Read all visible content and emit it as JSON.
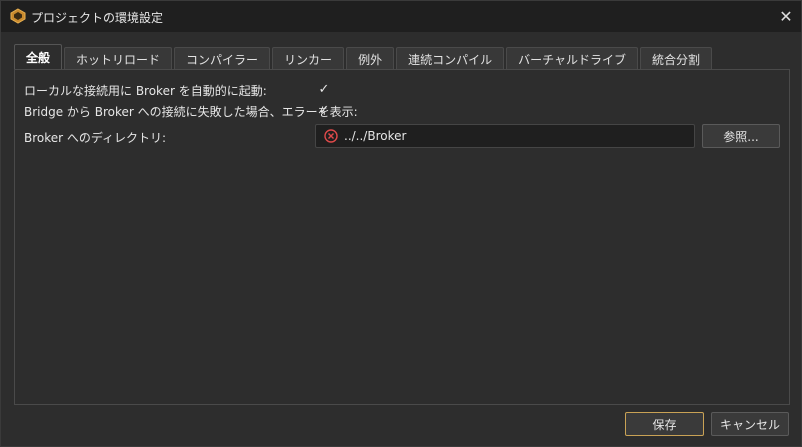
{
  "window": {
    "title": "プロジェクトの環境設定",
    "close_glyph": "✕"
  },
  "tabs": [
    {
      "label": "全般",
      "active": true
    },
    {
      "label": "ホットリロード"
    },
    {
      "label": "コンパイラー"
    },
    {
      "label": "リンカー"
    },
    {
      "label": "例外"
    },
    {
      "label": "連続コンパイル"
    },
    {
      "label": "バーチャルドライブ"
    },
    {
      "label": "統合分割"
    }
  ],
  "general": {
    "auto_start_label": "ローカルな接続用に Broker を自動的に起動:",
    "auto_start_checked": true,
    "show_error_label": "Bridge から Broker への接続に失敗した場合、エラーを表示:",
    "show_error_checked": true,
    "broker_dir_label": "Broker へのディレクトリ:",
    "broker_dir_value": "../../Broker",
    "browse_label": "参照..."
  },
  "footer": {
    "save_label": "保存",
    "cancel_label": "キャンセル"
  },
  "icons": {
    "check_glyph": "✓",
    "error_color": "#e04a4a",
    "accent_color": "#c9a255"
  }
}
